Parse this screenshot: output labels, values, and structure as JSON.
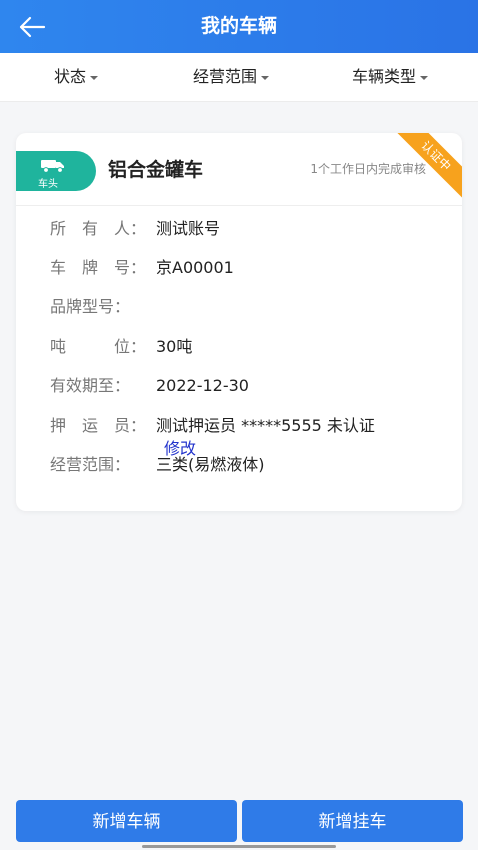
{
  "header": {
    "title": "我的车辆"
  },
  "filters": [
    {
      "label": "状态"
    },
    {
      "label": "经营范围"
    },
    {
      "label": "车辆类型"
    }
  ],
  "vehicle": {
    "tag_label": "车头",
    "name": "铝合金罐车",
    "review_note": "1个工作日内完成审核",
    "ribbon_label": "认证中",
    "fields": [
      {
        "label": "所　有　人：",
        "value": "测试账号"
      },
      {
        "label": "车　牌　号：",
        "value": "京A00001"
      },
      {
        "label": "品牌型号：",
        "value": ""
      },
      {
        "label": "吨　　　位：",
        "value": "30吨"
      },
      {
        "label": "有效期至：",
        "value": "2022-12-30"
      },
      {
        "label": "押　运　员：",
        "value": "测试押运员 *****5555 未认证"
      },
      {
        "label": "经营范围：",
        "value": "三类(易燃液体)"
      }
    ],
    "edit_label": "修改"
  },
  "actions": {
    "add_vehicle": "新增车辆",
    "add_trailer": "新增挂车"
  },
  "colors": {
    "header": "#2f7be8",
    "tag": "#1fb49d",
    "ribbon": "#f7a21d",
    "link": "#2233cc",
    "button": "#2f7be8"
  }
}
